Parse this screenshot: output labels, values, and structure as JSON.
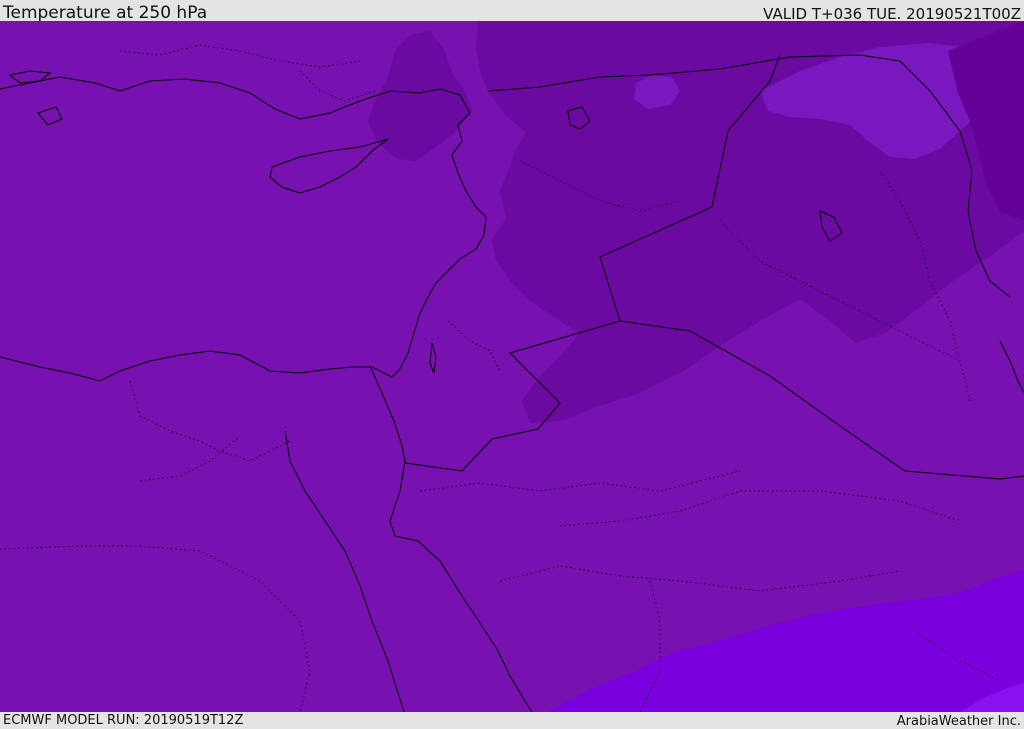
{
  "header": {
    "title": "Temperature at 250 hPa",
    "valid_time": "VALID T+036 TUE. 20190521T00Z"
  },
  "footer": {
    "model_run": "ECMWF MODEL RUN: 20190519T12Z",
    "provider": "ArabiaWeather Inc."
  },
  "map": {
    "field": "temperature",
    "level": "250 hPa",
    "region": "Eastern Mediterranean / Middle East",
    "colors": {
      "base": "#7711b0",
      "cold_pool": "#6a0aa0",
      "cold_core": "#650096",
      "warm_band": "#7a18bf",
      "warmer": "#7b00de",
      "warmest": "#8a10f0",
      "coastline": "#000000"
    }
  }
}
